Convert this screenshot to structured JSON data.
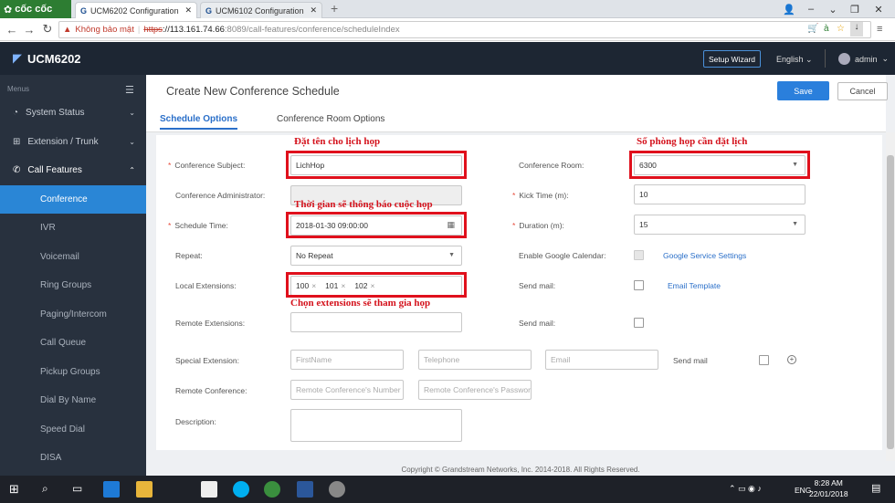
{
  "browser": {
    "brand": "cốc cốc",
    "tabs": [
      {
        "label": "UCM6202 Configuration",
        "active": true
      },
      {
        "label": "UCM6102 Configuration",
        "active": false
      }
    ],
    "new_tab": "+",
    "security_label": "Không bảo mật",
    "url_scheme": "https",
    "url_host": "://113.161.74.66",
    "url_path": ":8089/call-features/conference/scheduleIndex"
  },
  "app": {
    "product": "UCM6202",
    "setup_wizard": "Setup Wizard",
    "language": "English",
    "user": "admin"
  },
  "sidebar": {
    "menus_label": "Menus",
    "groups": [
      {
        "label": "System Status"
      },
      {
        "label": "Extension / Trunk"
      },
      {
        "label": "Call Features"
      }
    ],
    "items": [
      {
        "label": "Conference",
        "active": true
      },
      {
        "label": "IVR"
      },
      {
        "label": "Voicemail"
      },
      {
        "label": "Ring Groups"
      },
      {
        "label": "Paging/Intercom"
      },
      {
        "label": "Call Queue"
      },
      {
        "label": "Pickup Groups"
      },
      {
        "label": "Dial By Name"
      },
      {
        "label": "Speed Dial"
      },
      {
        "label": "DISA"
      }
    ]
  },
  "page": {
    "title": "Create New Conference Schedule",
    "save": "Save",
    "cancel": "Cancel",
    "tabs": [
      "Schedule Options",
      "Conference Room Options"
    ]
  },
  "form": {
    "conference_subject": {
      "label": "Conference Subject:",
      "value": "LichHop"
    },
    "conference_room": {
      "label": "Conference Room:",
      "value": "6300"
    },
    "conference_administrator": {
      "label": "Conference Administrator:"
    },
    "kick_time": {
      "label": "Kick Time (m):",
      "value": "10"
    },
    "schedule_time": {
      "label": "Schedule Time:",
      "value": "2018-01-30 09:00:00"
    },
    "duration": {
      "label": "Duration (m):",
      "value": "15"
    },
    "repeat": {
      "label": "Repeat:",
      "value": "No Repeat"
    },
    "enable_google_calendar": {
      "label": "Enable Google Calendar:"
    },
    "google_service_settings": "Google Service Settings",
    "local_extensions": {
      "label": "Local Extensions:",
      "values": [
        "100",
        "101",
        "102"
      ]
    },
    "send_mail_1": {
      "label": "Send mail:"
    },
    "email_template": "Email Template",
    "remote_extensions": {
      "label": "Remote Extensions:"
    },
    "send_mail_2": {
      "label": "Send mail:"
    },
    "special_extension": {
      "label": "Special Extension:",
      "placeholders": [
        "FirstName",
        "Telephone",
        "Email"
      ],
      "send_mail": "Send mail"
    },
    "remote_conference": {
      "label": "Remote Conference:",
      "placeholders": [
        "Remote Conference's Number",
        "Remote Conference's Password"
      ]
    },
    "description": {
      "label": "Description:"
    }
  },
  "annotations": {
    "subject": "Đặt tên cho lịch họp",
    "room": "Số phòng họp cần đặt lịch",
    "time": "Thời gian sẽ thông báo cuộc họp",
    "extensions": "Chọn extensions sẽ tham gia họp"
  },
  "footer": "Copyright © Grandstream Networks, Inc. 2014-2018. All Rights Reserved.",
  "taskbar": {
    "time": "8:28 AM",
    "date": "22/01/2018",
    "lang": "ENG"
  },
  "colors": {
    "sidebar_bg": "#28313e",
    "header_bg": "#1d2633",
    "accent": "#2a7fdc",
    "annotation": "#d4121c"
  }
}
